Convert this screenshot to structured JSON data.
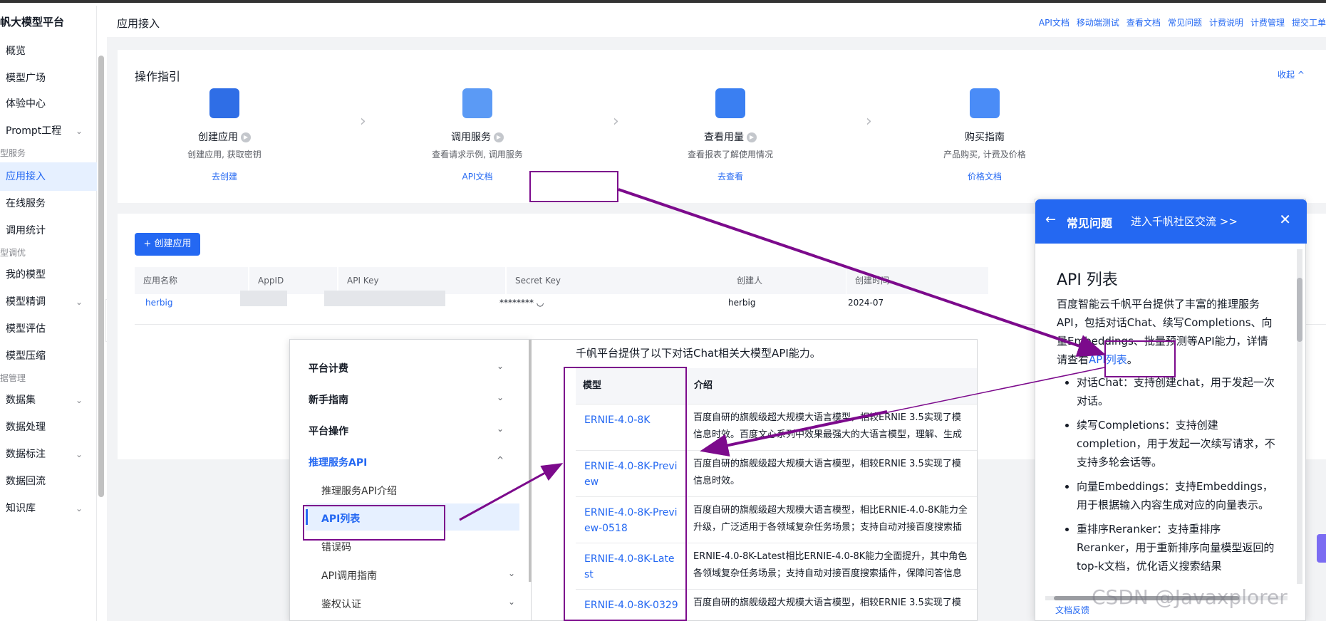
{
  "app": {
    "brand": "帆大模型平台",
    "page_title": "应用接入"
  },
  "header_links": [
    "API文档",
    "移动端测试",
    "查看文档",
    "常见问题",
    "计费说明",
    "计费管理",
    "提交工单"
  ],
  "sidebar": {
    "items": [
      {
        "label": "概览"
      },
      {
        "label": "模型广场"
      },
      {
        "label": "体验中心"
      },
      {
        "label": "Prompt工程",
        "chevron": "⌄"
      },
      {
        "group": "型服务"
      },
      {
        "label": "应用接入",
        "active": true
      },
      {
        "label": "在线服务"
      },
      {
        "label": "调用统计"
      },
      {
        "group": "型调优"
      },
      {
        "label": "我的模型"
      },
      {
        "label": "模型精调",
        "chevron": "⌄"
      },
      {
        "label": "模型评估"
      },
      {
        "label": "模型压缩"
      },
      {
        "group": "据管理"
      },
      {
        "label": "数据集",
        "chevron": "⌄"
      },
      {
        "label": "数据处理"
      },
      {
        "label": "数据标注",
        "chevron": "⌄"
      },
      {
        "label": "数据回流"
      },
      {
        "label": "知识库",
        "chevron": "⌄"
      }
    ],
    "collapse_arrow": "‹"
  },
  "guide": {
    "title": "操作指引",
    "collapse_label": "收起 ^",
    "steps": [
      {
        "title": "创建应用",
        "desc": "创建应用, 获取密钥",
        "link": "去创建"
      },
      {
        "title": "调用服务",
        "desc": "查看请求示例, 调用服务",
        "link": "API文档"
      },
      {
        "title": "查看用量",
        "desc": "查看报表了解使用情况",
        "link": "去查看"
      },
      {
        "title": "购买指南",
        "desc": "产品购买, 计费及价格",
        "link": "价格文档"
      }
    ],
    "separator": "›",
    "play": "▶"
  },
  "apps": {
    "create_label": "+ 创建应用",
    "columns": [
      "应用名称",
      "AppID",
      "API Key",
      "Secret Key",
      "创建人",
      "创建时间"
    ],
    "row": {
      "name": "herbig",
      "secret": "******** ◡",
      "creator": "herbig",
      "created": "2024-07"
    }
  },
  "docnav": {
    "items": [
      {
        "label": "平台计费",
        "chevron": "⌄"
      },
      {
        "label": "新手指南",
        "chevron": "⌄"
      },
      {
        "label": "平台操作",
        "chevron": "⌄"
      },
      {
        "label": "推理服务API",
        "chevron": "^"
      }
    ],
    "subs": [
      {
        "label": "推理服务API介绍"
      },
      {
        "label": "API列表",
        "active": true
      },
      {
        "label": "错误码"
      },
      {
        "label": "API调用指南",
        "chevron": "⌄"
      },
      {
        "label": "鉴权认证",
        "chevron": "⌄"
      }
    ]
  },
  "doccontent": {
    "intro": "千帆平台提供了以下对话Chat相关大模型API能力。",
    "head_model": "模型",
    "head_desc": "介绍",
    "rows": [
      {
        "model": [
          "ERNIE-4.0-8K"
        ],
        "desc": [
          "百度自研的旗舰级超大规模大语言模型，相较ERNIE 3.5实现了模",
          "信息时效。百度文心系列中效果最强大的大语言模型，理解、生成"
        ]
      },
      {
        "model": [
          "ERNIE-4.0-8K-Previ",
          "ew"
        ],
        "desc": [
          "百度自研的旗舰级超大规模大语言模型，相较ERNIE 3.5实现了模",
          "信息时效。"
        ]
      },
      {
        "model": [
          "ERNIE-4.0-8K-Previ",
          "ew-0518"
        ],
        "desc": [
          "百度自研的旗舰级超大规模大语言模型，相比ERNIE-4.0-8K能力全",
          "升级，广泛适用于各领域复杂任务场景；支持自动对接百度搜索插"
        ]
      },
      {
        "model": [
          "ERNIE-4.0-8K-Late",
          "st"
        ],
        "desc": [
          "ERNIE-4.0-8K-Latest相比ERNIE-4.0-8K能力全面提升，其中角色",
          "各领域复杂任务场景；支持自动对接百度搜索插件，保障问答信息"
        ]
      },
      {
        "model": [
          "ERNIE-4.0-8K-0329"
        ],
        "desc": [
          "百度自研的旗舰级超大规模大语言模型，相较ERNIE 3.5实现了模"
        ]
      }
    ]
  },
  "faq": {
    "back": "←",
    "title": "常见问题",
    "community": "进入千帆社区交流 >>",
    "close": "✕",
    "heading": "API 列表",
    "para_before": "百度智能云千帆平台提供了丰富的推理服务API，包括对话Chat、续写Completions、向量Embeddings、批量预测等API能力，详情请查看",
    "para_link": "API列表",
    "para_after": "。",
    "bullets": [
      "对话Chat：支持创建chat，用于发起一次对话。",
      "续写Completions：支持创建completion，用于发起一次续写请求，不支持多轮会话等。",
      "向量Embeddings：支持Embeddings，用于根据输入内容生成对应的向量表示。",
      "重排序Reranker：支持重排序Reranker，用于重新排序向量模型返回的top-k文档，优化语义搜索结果"
    ],
    "footer": "文档反馈"
  },
  "watermark": "CSDN @Javaxplorer",
  "colors": {
    "accent": "#2468f2",
    "annotation": "#7c0a8c",
    "sidebar_active": "#e6f0ff"
  },
  "icons": [
    "plus-screen-icon",
    "code-monitor-icon",
    "chart-monitor-icon",
    "guide-doc-icon",
    "play-icon",
    "chevron-right-icon",
    "chevron-down-icon",
    "chevron-up-icon",
    "back-arrow-icon",
    "close-icon"
  ]
}
